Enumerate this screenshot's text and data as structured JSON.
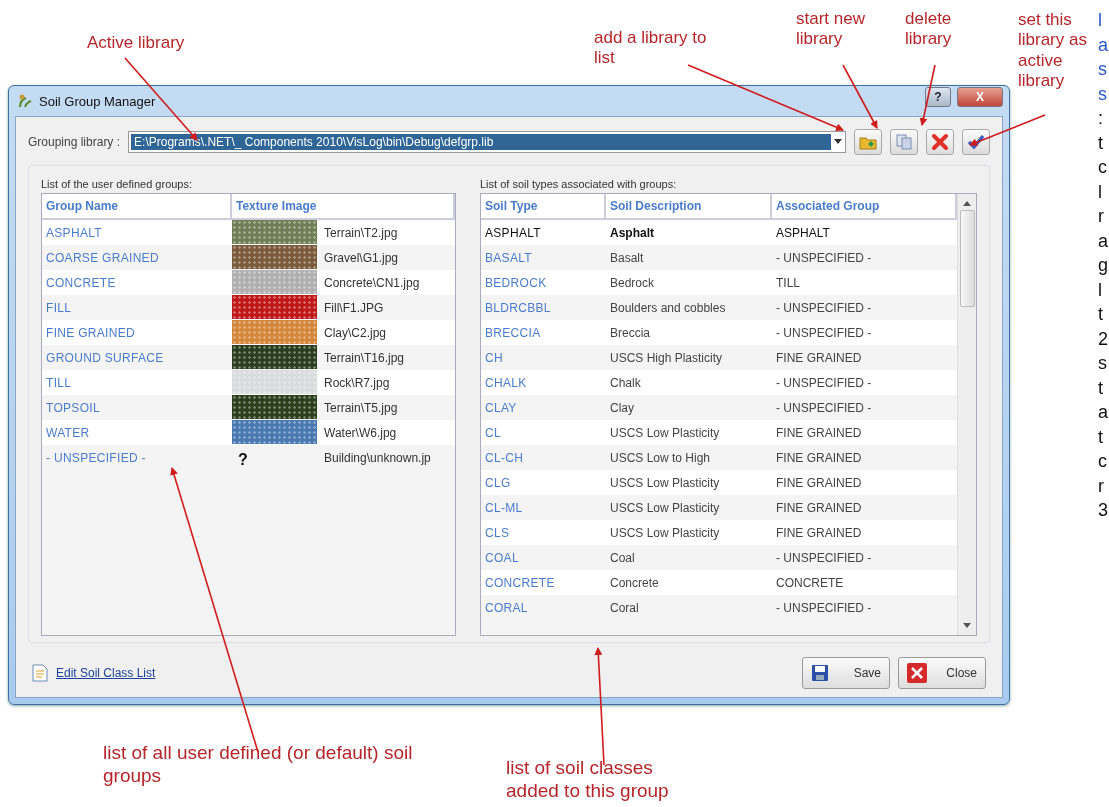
{
  "annotations": [
    {
      "kind": "top",
      "text": "Active library"
    },
    {
      "kind": "top",
      "text": "add a library to list"
    },
    {
      "kind": "top",
      "text": "start new library"
    },
    {
      "kind": "top",
      "text": "delete library"
    },
    {
      "kind": "top",
      "text": "set this library as active library"
    },
    {
      "kind": "bottom",
      "text": "list of all user defined (or default) soil groups"
    },
    {
      "kind": "bottom",
      "text": "list of soil classes added to this group"
    }
  ],
  "window": {
    "title": "Soil Group Manager",
    "title_buttons": [
      "?",
      "X"
    ]
  },
  "library": {
    "label": "Grouping library :",
    "value": "E:\\Programs\\.NET\\_ Components 2010\\VisLog\\bin\\Debug\\defgrp.lib"
  },
  "toolbar": [
    {
      "kind": "add"
    },
    {
      "kind": "new"
    },
    {
      "kind": "delete"
    },
    {
      "kind": "activate"
    }
  ],
  "groups_table": {
    "caption": "List of the user defined groups:",
    "columns": [
      "Group Name",
      "Texture Image"
    ],
    "rows": [
      {
        "name": "ASPHALT",
        "texture": {
          "kind": "image",
          "color": "#6f7f55"
        },
        "file": "Terrain\\T2.jpg"
      },
      {
        "name": "COARSE GRAINED",
        "texture": {
          "kind": "image",
          "color": "#7a5a3a"
        },
        "file": "Gravel\\G1.jpg"
      },
      {
        "name": "CONCRETE",
        "texture": {
          "kind": "image",
          "color": "#b0b0b0"
        },
        "file": "Concrete\\CN1.jpg"
      },
      {
        "name": "FILL",
        "texture": {
          "kind": "image",
          "color": "#c01818"
        },
        "file": "Fill\\F1.JPG"
      },
      {
        "name": "FINE GRAINED",
        "texture": {
          "kind": "image",
          "color": "#d4863a"
        },
        "file": "Clay\\C2.jpg"
      },
      {
        "name": "GROUND SURFACE",
        "texture": {
          "kind": "image",
          "color": "#2a3d1e"
        },
        "file": "Terrain\\T16.jpg"
      },
      {
        "name": "TILL",
        "texture": {
          "kind": "image",
          "color": "#d8dcdc"
        },
        "file": "Rock\\R7.jpg"
      },
      {
        "name": "TOPSOIL",
        "texture": {
          "kind": "image",
          "color": "#2c3f1c"
        },
        "file": "Terrain\\T5.jpg"
      },
      {
        "name": "WATER",
        "texture": {
          "kind": "image",
          "color": "#4a78b0"
        },
        "file": "Water\\W6.jpg"
      },
      {
        "name": "- UNSPECIFIED -",
        "texture": {
          "kind": "unknown",
          "glyph": "?"
        },
        "file": "Building\\unknown.jp"
      }
    ]
  },
  "soil_table": {
    "caption": "List of soil types associated with groups:",
    "columns": [
      "Soil Type",
      "Soil Description",
      "Associated Group"
    ],
    "rows": [
      {
        "type": "ASPHALT",
        "description": "Asphalt",
        "group": "ASPHALT",
        "selected": true
      },
      {
        "type": "BASALT",
        "description": "Basalt",
        "group": "- UNSPECIFIED -",
        "selected": false
      },
      {
        "type": "BEDROCK",
        "description": "Bedrock",
        "group": "TILL",
        "selected": false
      },
      {
        "type": "BLDRCBBL",
        "description": "Boulders and cobbles",
        "group": "- UNSPECIFIED -",
        "selected": false
      },
      {
        "type": "BRECCIA",
        "description": "Breccia",
        "group": "- UNSPECIFIED -",
        "selected": false
      },
      {
        "type": "CH",
        "description": "USCS High Plasticity",
        "group": "FINE GRAINED",
        "selected": false
      },
      {
        "type": "CHALK",
        "description": "Chalk",
        "group": "- UNSPECIFIED -",
        "selected": false
      },
      {
        "type": "CLAY",
        "description": "Clay",
        "group": "- UNSPECIFIED -",
        "selected": false
      },
      {
        "type": "CL",
        "description": "USCS Low Plasticity",
        "group": "FINE GRAINED",
        "selected": false
      },
      {
        "type": "CL-CH",
        "description": "USCS Low to High",
        "group": "FINE GRAINED",
        "selected": false
      },
      {
        "type": "CLG",
        "description": "USCS Low Plasticity",
        "group": "FINE GRAINED",
        "selected": false
      },
      {
        "type": "CL-ML",
        "description": "USCS Low Plasticity",
        "group": "FINE GRAINED",
        "selected": false
      },
      {
        "type": "CLS",
        "description": "USCS Low Plasticity",
        "group": "FINE GRAINED",
        "selected": false
      },
      {
        "type": "COAL",
        "description": "Coal",
        "group": "- UNSPECIFIED -",
        "selected": false
      },
      {
        "type": "CONCRETE",
        "description": "Concrete",
        "group": "CONCRETE",
        "selected": false
      },
      {
        "type": "CORAL",
        "description": "Coral",
        "group": "- UNSPECIFIED -",
        "selected": false
      }
    ]
  },
  "edit_link": "Edit Soil Class List",
  "buttons": [
    {
      "kind": "save",
      "label": "Save"
    },
    {
      "kind": "close",
      "label": "Close"
    }
  ],
  "page_edge_letters": [
    "l",
    "a",
    "s",
    "s",
    ":",
    "t",
    "c",
    "l",
    "r",
    "a",
    "g",
    "l",
    "t",
    "2",
    "s",
    "t",
    "a",
    "t",
    "c",
    "r",
    "3"
  ]
}
